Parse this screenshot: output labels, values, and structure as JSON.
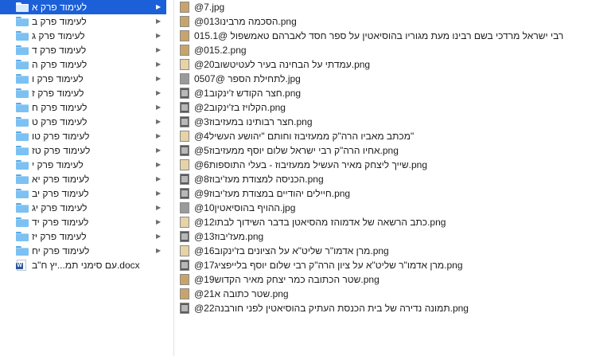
{
  "folders": [
    {
      "label": "לעימוד פרק א",
      "selected": true
    },
    {
      "label": "לעימוד פרק ב"
    },
    {
      "label": "לעימוד פרק ג"
    },
    {
      "label": "לעימוד פרק ד"
    },
    {
      "label": "לעימוד פרק ה"
    },
    {
      "label": "לעימוד פרק ו"
    },
    {
      "label": "לעימוד פרק ז"
    },
    {
      "label": "לעימוד פרק ח"
    },
    {
      "label": "לעימוד פרק ט"
    },
    {
      "label": "לעימוד פרק טו"
    },
    {
      "label": "לעימוד פרק טז"
    },
    {
      "label": "לעימוד פרק י"
    },
    {
      "label": "לעימוד פרק יא"
    },
    {
      "label": "לעימוד פרק יב"
    },
    {
      "label": "לעימוד פרק יג"
    },
    {
      "label": "לעימוד פרק יד"
    },
    {
      "label": "לעימוד פרק יז"
    },
    {
      "label": "לעימוד פרק יח"
    }
  ],
  "document": {
    "label": "עם סימני תמ...יץ ח\"ב.docx",
    "icon": "word-doc-icon",
    "icon_letter": "W"
  },
  "files": [
    {
      "label": "@7.jpg",
      "thumb": "sepia"
    },
    {
      "label": "@013הסכמה מרבינו.png",
      "thumb": "sepia"
    },
    {
      "label": "015.1@ רבי ישראל מרדכי בשם רבינו מעת מגוריו בהוסיאטין על ספר חסד לאברהם טאמשפול",
      "thumb": "sepia"
    },
    {
      "label": "@015.2.png",
      "thumb": "sepia"
    },
    {
      "label": "@20עמדתי על הבחינה בעיר לעטיטשוב.png",
      "thumb": "light"
    },
    {
      "label": "0507@ לתחילת הספר.jpg",
      "thumb": "gray"
    },
    {
      "label": "@1חצר הקודש ז'ינקוב.png",
      "thumb": "photo"
    },
    {
      "label": "@2הקלויז בז'ינקוב.png",
      "thumb": "photo"
    },
    {
      "label": "@3חצר רבותינו במעזיבוז.png",
      "thumb": "photo"
    },
    {
      "label": "@4מכתב מאביו הרה\"ק ממעזיבוז וחותם \"יהושע העשיל\"",
      "thumb": "light"
    },
    {
      "label": "@5אחיו הרה\"ק רבי ישראל שלום יוסף ממעזיבוז.png",
      "thumb": "photo"
    },
    {
      "label": "@6שייך ליצחק מאיר העשיל ממעזיבוז - בעלי התוספות.png",
      "thumb": "light"
    },
    {
      "label": "@8הכניסה למצודת מעז'יבוז.png",
      "thumb": "photo"
    },
    {
      "label": "@9חיילים יהודיים במצודת מעז'יבוז.png",
      "thumb": "photo"
    },
    {
      "label": "@10ההויף בהוסיאטין.jpg",
      "thumb": "gray"
    },
    {
      "label": "@12כתב הרשאה של אדמוהז מהסיאטן בדבר השידוך לבתו.png",
      "thumb": "light"
    },
    {
      "label": "@13מעז'יבוז.png",
      "thumb": "photo"
    },
    {
      "label": "@16מרן אדמו\"ר שליט\"א על הציונים בז'ינקוב.png",
      "thumb": "light"
    },
    {
      "label": "@17מרן אדמו\"ר שליט\"א על ציון הרה\"ק רבי שלום יוסף בלייפציג.png",
      "thumb": "photo"
    },
    {
      "label": "@19שטר הכתובה כמר יצחק מאיר הקדוש.png",
      "thumb": "sepia"
    },
    {
      "label": "@21שטר כתובה א.png",
      "thumb": "sepia"
    },
    {
      "label": "@22תמונה נדירה של בית הכנסת העתיק בהוסיאטין לפני חורבנה.png",
      "thumb": "photo"
    }
  ],
  "colors": {
    "selection": "#1b60d8",
    "folder": "#7cc1f2"
  }
}
